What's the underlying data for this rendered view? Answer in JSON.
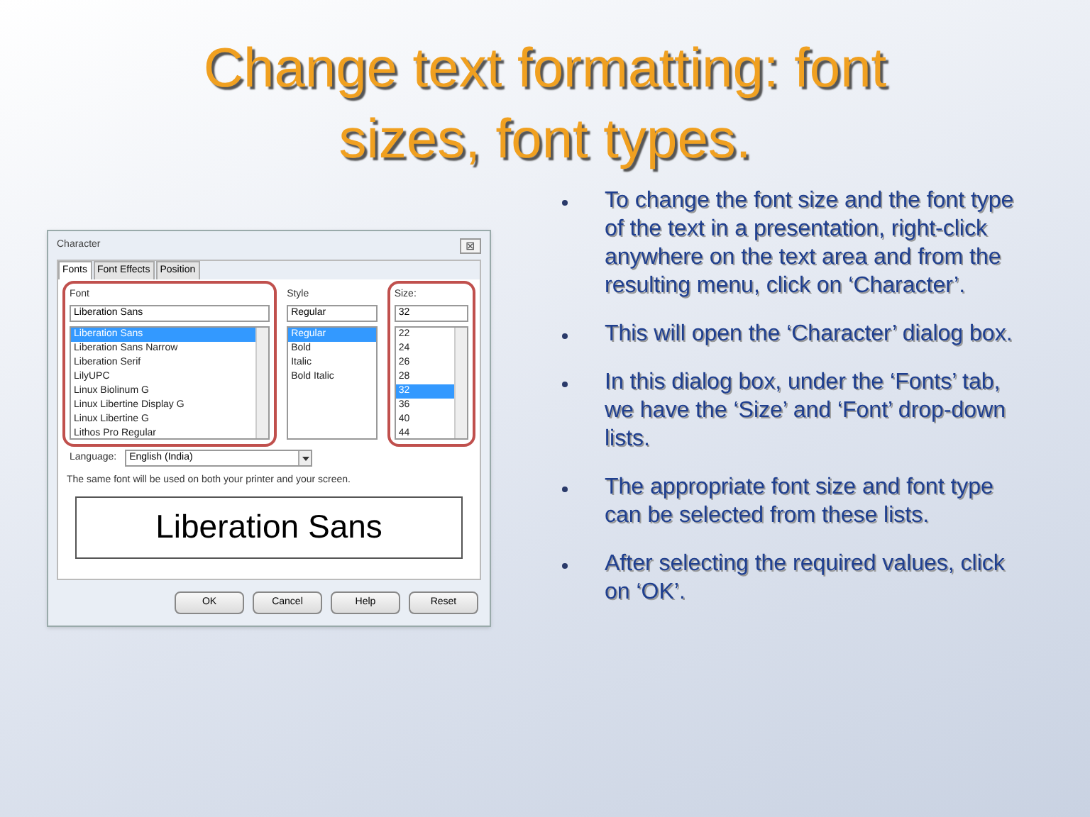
{
  "slide_title": "Change text formatting: font sizes, font types.",
  "dialog": {
    "title": "Character",
    "close": "⊠",
    "tabs": [
      {
        "label": "Fonts",
        "selected": true
      },
      {
        "label": "Font Effects",
        "selected": false
      },
      {
        "label": "Position",
        "selected": false
      }
    ],
    "font": {
      "label": "Font",
      "value": "Liberation Sans",
      "highlighted": true,
      "items": [
        {
          "label": "Liberation Sans",
          "selected": true
        },
        {
          "label": "Liberation Sans Narrow",
          "selected": false
        },
        {
          "label": "Liberation Serif",
          "selected": false
        },
        {
          "label": "LilyUPC",
          "selected": false
        },
        {
          "label": "Linux Biolinum G",
          "selected": false
        },
        {
          "label": "Linux Libertine Display G",
          "selected": false
        },
        {
          "label": "Linux Libertine G",
          "selected": false
        },
        {
          "label": "Lithos Pro Regular",
          "selected": false
        }
      ]
    },
    "style": {
      "label": "Style",
      "value": "Regular",
      "highlighted": false,
      "items": [
        {
          "label": "Regular",
          "selected": true
        },
        {
          "label": "Bold",
          "selected": false
        },
        {
          "label": "Italic",
          "selected": false
        },
        {
          "label": "Bold Italic",
          "selected": false
        }
      ]
    },
    "size": {
      "label": "Size:",
      "value": "32",
      "highlighted": true,
      "items": [
        {
          "label": "22",
          "selected": false
        },
        {
          "label": "24",
          "selected": false
        },
        {
          "label": "26",
          "selected": false
        },
        {
          "label": "28",
          "selected": false
        },
        {
          "label": "32",
          "selected": true
        },
        {
          "label": "36",
          "selected": false
        },
        {
          "label": "40",
          "selected": false
        },
        {
          "label": "44",
          "selected": false
        }
      ]
    },
    "language": {
      "label": "Language:",
      "value": "English (India)"
    },
    "note": "The same font will be used on both your printer and your screen.",
    "preview": "Liberation Sans",
    "buttons": [
      "OK",
      "Cancel",
      "Help",
      "Reset"
    ]
  },
  "bullets": [
    "To change the font size and the font type of the text in a presentation, right-click anywhere on the text area and from the resulting menu, click on ‘Character’.",
    "This will open the ‘Character’ dialog box.",
    "In this dialog box, under the ‘Fonts’ tab, we have the ‘Size’ and ‘Font’ drop-down lists.",
    "The appropriate font size and font type can be selected from these lists.",
    "After selecting the required values, click on ‘OK’."
  ]
}
